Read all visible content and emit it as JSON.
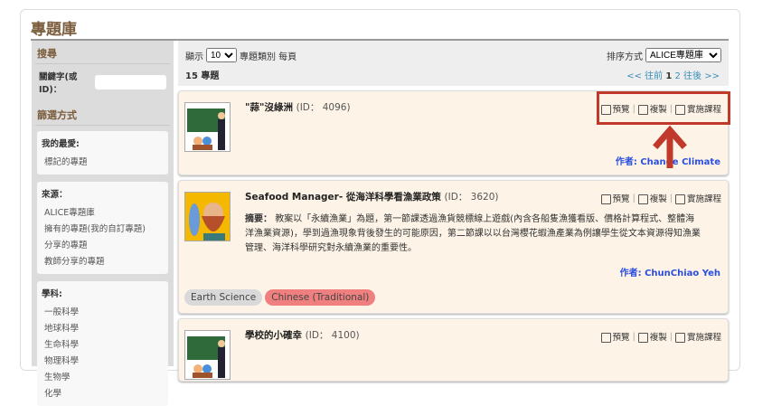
{
  "page": {
    "title": "專題庫"
  },
  "sidebar": {
    "search_heading": "搜尋",
    "keyword_label": "關鍵字(或ID)：",
    "keyword_value": "",
    "filter_heading": "篩選方式",
    "groups": [
      {
        "label": "我的最愛:",
        "items": [
          "標記的專題"
        ]
      },
      {
        "label": "來源：",
        "items": [
          "ALICE專題庫",
          "擁有的專題(我的自訂專題)",
          "分享的專題",
          "教師分享的專題"
        ]
      },
      {
        "label": "學科:",
        "items": [
          "一般科學",
          "地球科學",
          "生命科學",
          "物理科學",
          "生物學",
          "化學"
        ]
      }
    ]
  },
  "controls": {
    "show_label": "顯示",
    "per_page": "10",
    "per_page_suffix": "專題類別 每頁",
    "sort_label": "排序方式",
    "sort_value": "ALICE專題庫",
    "count": "15 專題",
    "pager": {
      "prev_first": "<<",
      "prev": "往前",
      "current": "1",
      "page2": "2",
      "next": "往後",
      "last": ">>"
    }
  },
  "actions": {
    "preview": "預覽",
    "copy": "複製",
    "implement": "實施課程"
  },
  "highlight_color": "#c0392b",
  "cards": [
    {
      "title": "\"蒜\"沒綠洲",
      "id": "(ID： 4096)",
      "author": "作者: Change Climate"
    },
    {
      "title": "Seafood Manager- 從海洋科學看漁業政策",
      "id": "(ID： 3620)",
      "summary_label": "摘要：",
      "summary": "教案以「永續漁業」為題，第一節課透過漁貨競標線上遊戲(內含各船隻漁獲看版、價格計算程式、整體海洋漁業資源)，學到過漁現象背後發生的可能原因，第二節課以以台灣櫻花蝦漁產業為例讓學生從文本資源得知漁業管理、海洋科學研究對永續漁業的重要性。",
      "author": "作者: ChunChiao Yeh",
      "tags": [
        {
          "label": "Earth Science",
          "color": "#d9d9d9"
        },
        {
          "label": "Chinese (Traditional)",
          "color": "#f08080"
        }
      ]
    },
    {
      "title": "學校的小確幸",
      "id": "(ID： 4100)"
    }
  ]
}
